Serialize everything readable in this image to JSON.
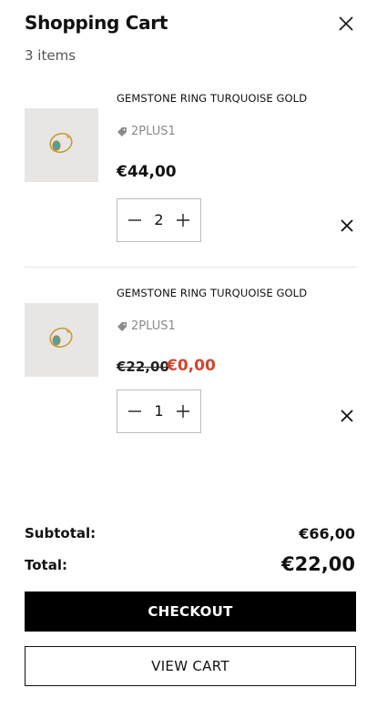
{
  "header": {
    "title": "Shopping Cart",
    "item_count": "3 items",
    "close_icon": "close-icon"
  },
  "items": [
    {
      "name": "GEMSTONE RING TURQUOISE GOLD",
      "tag": "2PLUS1",
      "price": "€44,00",
      "quantity": "2"
    },
    {
      "name": "GEMSTONE RING TURQUOISE GOLD",
      "tag": "2PLUS1",
      "old_price": "€22,00",
      "sale_price": "€0,00",
      "quantity": "1"
    }
  ],
  "summary": {
    "subtotal_label": "Subtotal:",
    "subtotal_value": "€66,00",
    "total_label": "Total:",
    "total_value": "€22,00"
  },
  "actions": {
    "checkout_label": "CHECKOUT",
    "view_cart_label": "VIEW CART"
  },
  "colors": {
    "sale": "#d6442c",
    "primary_button": "#000000"
  }
}
